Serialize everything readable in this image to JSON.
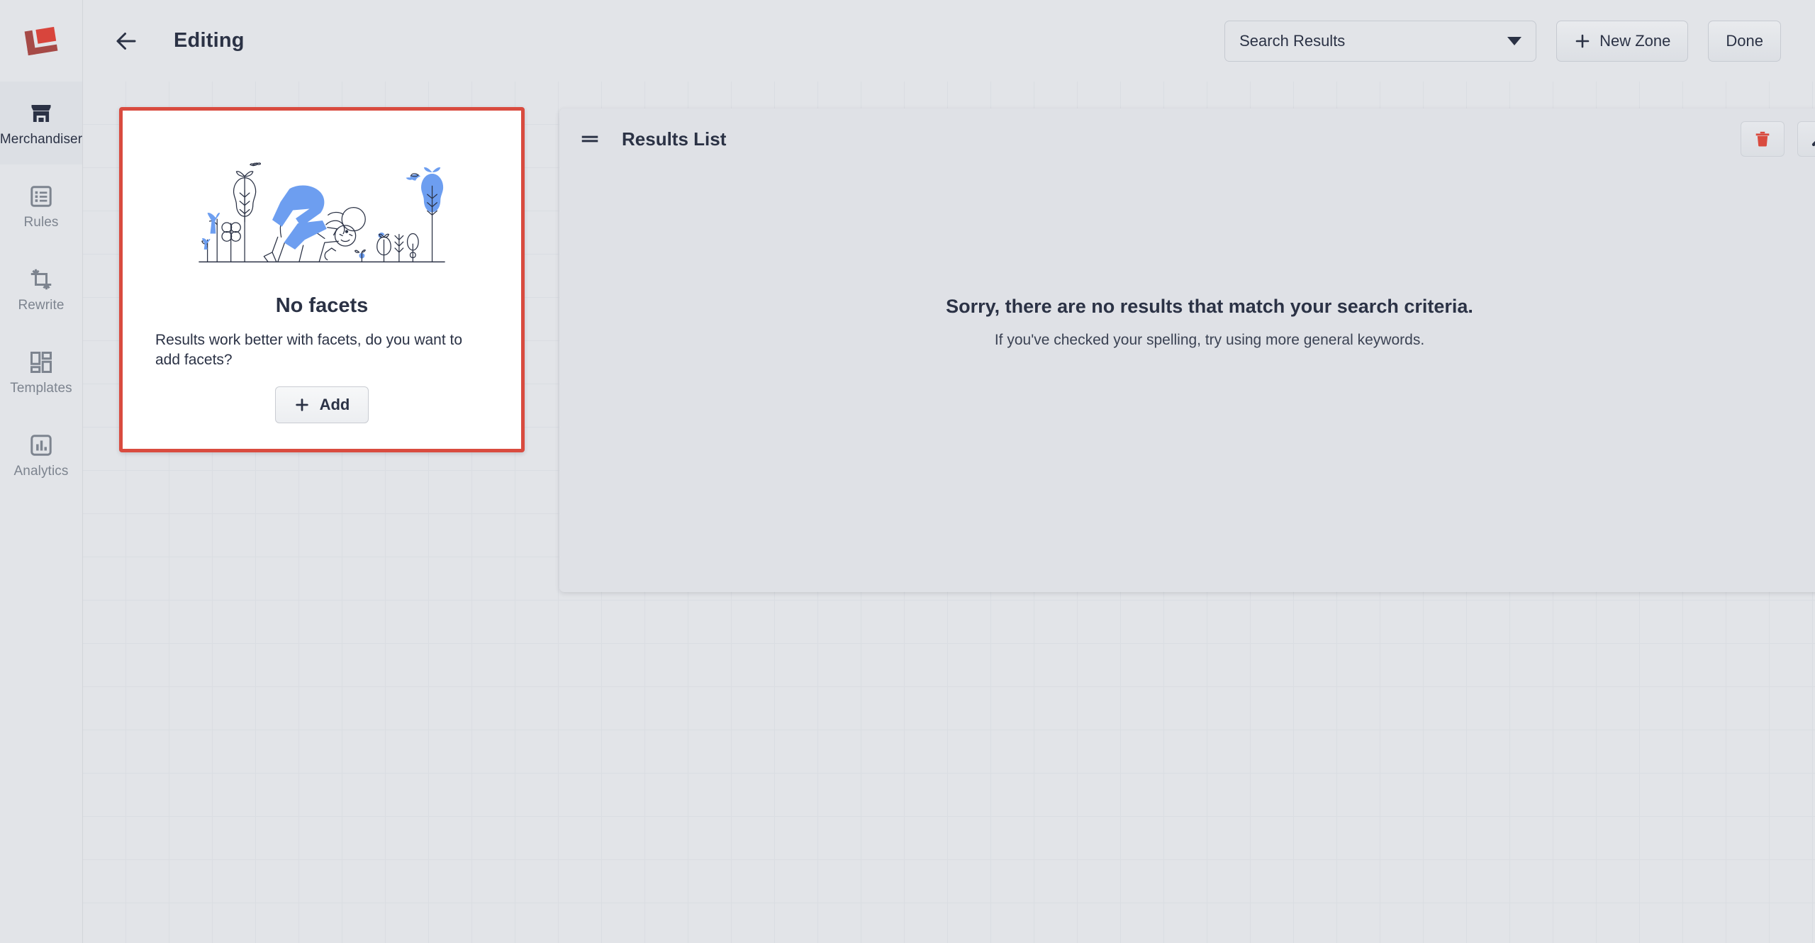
{
  "app": {
    "logo_icon": "lucidworks-logo-icon",
    "accent_red": "#d94b3f",
    "canvas_bg": "#e2e4e8",
    "text_dark": "#2b3245"
  },
  "sidebar": {
    "items": [
      {
        "label": "Merchandiser",
        "icon": "storefront-icon",
        "active": true
      },
      {
        "label": "Rules",
        "icon": "list-rules-icon",
        "active": false
      },
      {
        "label": "Rewrite",
        "icon": "crop-rewrite-icon",
        "active": false
      },
      {
        "label": "Templates",
        "icon": "grid-templates-icon",
        "active": false
      },
      {
        "label": "Analytics",
        "icon": "bar-chart-icon",
        "active": false
      }
    ]
  },
  "topbar": {
    "back_icon": "arrow-left-icon",
    "title": "Editing",
    "zone_select": {
      "value": "Search Results",
      "caret_icon": "chevron-down-icon"
    },
    "new_zone_label": "New Zone",
    "new_zone_icon": "plus-icon",
    "done_label": "Done"
  },
  "facets_card": {
    "illustration": "gardening-person-plants-illustration",
    "title": "No facets",
    "description": "Results work better with facets, do you want to add facets?",
    "add_label": "Add",
    "add_icon": "plus-icon",
    "selected_border_color": "#d94b3f"
  },
  "results_panel": {
    "drag_icon": "drag-handle-icon",
    "title": "Results List",
    "delete_icon": "trash-icon",
    "settings_icon": "wrench-icon",
    "empty_title": "Sorry, there are no results that match your search criteria.",
    "empty_subtitle": "If you've checked your spelling, try using more general keywords."
  }
}
